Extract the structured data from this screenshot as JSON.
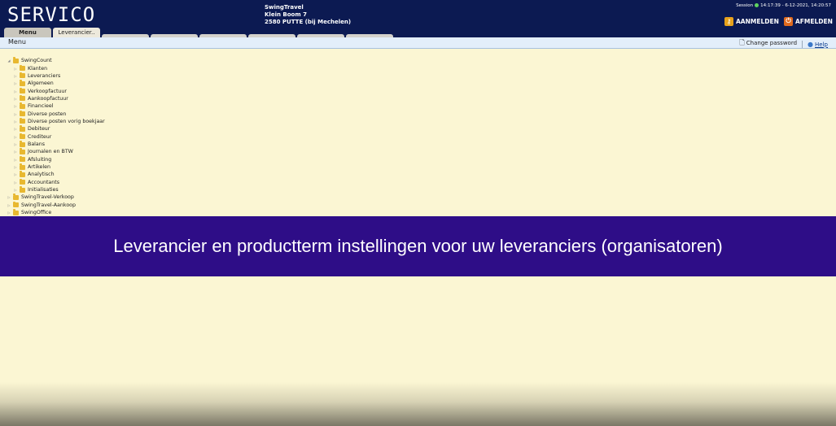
{
  "header": {
    "logo": "SERVICO",
    "company_name": "SwingTravel",
    "company_address": "Klein Boom 7",
    "company_city": "2580 PUTTE (bij Mechelen)",
    "session_label": "Session",
    "session_time": "14:17:39 - 6-12-2021, 14:20:57",
    "login_label": "AANMELDEN",
    "logout_label": "AFMELDEN"
  },
  "tabs": [
    {
      "label": "Menu"
    },
    {
      "label": "Leverancier.."
    }
  ],
  "menubar": {
    "label": "Menu",
    "change_password": "Change password",
    "help": "Help"
  },
  "tree": {
    "root": "SwingCount",
    "children": [
      "Klanten",
      "Leveranciers",
      "Algemeen",
      "Verkoopfactuur",
      "Aankoopfactuur",
      "Financieel",
      "Diverse posten",
      "Diverse posten vorig boekjaar",
      "Debiteur",
      "Crediteur",
      "Balans",
      "Journalen en BTW",
      "Afsluiting",
      "Artikelen",
      "Analytisch",
      "Accountants",
      "Initialisaties"
    ],
    "siblings": [
      "SwingTravel-Verkoop",
      "SwingTravel-Aankoop",
      "SwingOffice"
    ]
  },
  "banner": {
    "text": "Leverancier en productterm instellingen voor uw leveranciers (organisatoren)"
  },
  "colors": {
    "header_bg": "#0c1a52",
    "page_bg": "#fbf6d3",
    "banner_bg": "#2e0d87"
  }
}
